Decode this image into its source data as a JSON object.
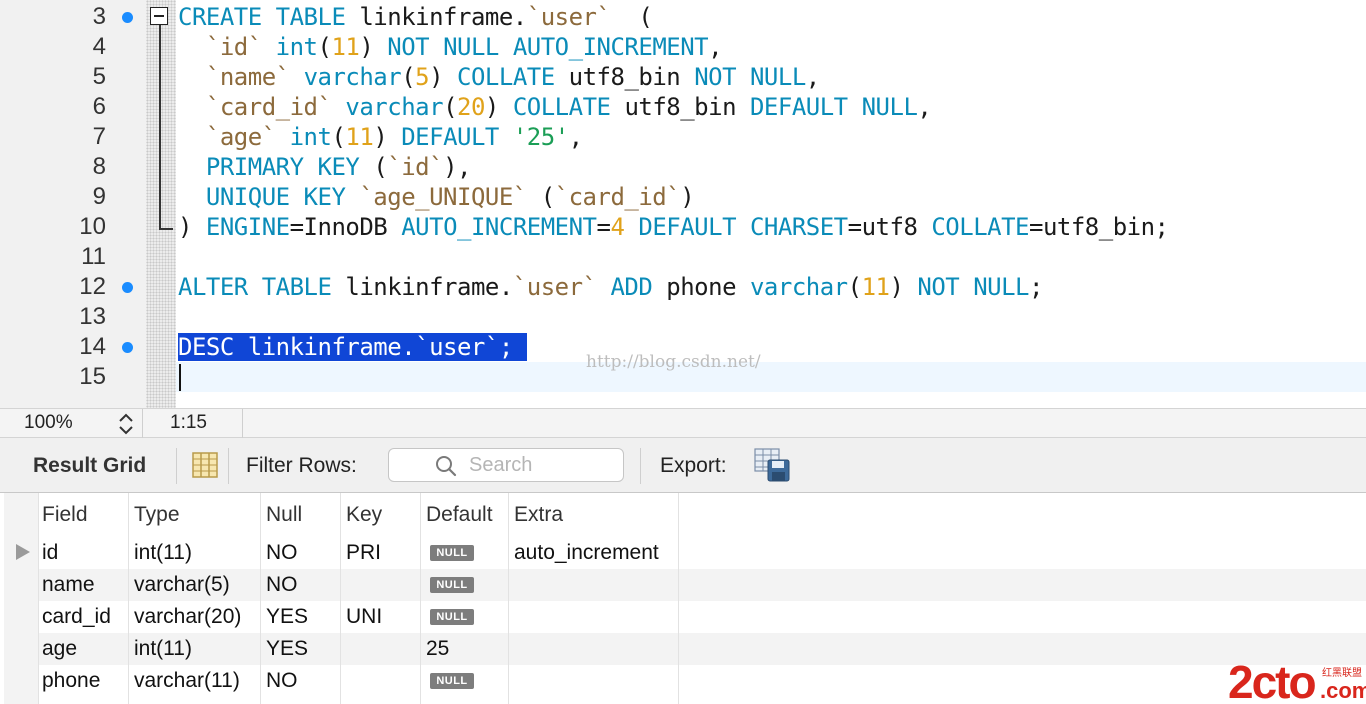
{
  "editor": {
    "lines": [
      {
        "num": "3",
        "marker": true
      },
      {
        "num": "4",
        "marker": false
      },
      {
        "num": "5",
        "marker": false
      },
      {
        "num": "6",
        "marker": false
      },
      {
        "num": "7",
        "marker": false
      },
      {
        "num": "8",
        "marker": false
      },
      {
        "num": "9",
        "marker": false
      },
      {
        "num": "10",
        "marker": false
      },
      {
        "num": "11",
        "marker": false
      },
      {
        "num": "12",
        "marker": true
      },
      {
        "num": "13",
        "marker": false
      },
      {
        "num": "14",
        "marker": true
      },
      {
        "num": "15",
        "marker": false
      }
    ],
    "code": {
      "l3": [
        "CREATE",
        "TABLE",
        "linkinframe.",
        "`user`",
        "("
      ],
      "l4": [
        "`id`",
        "int",
        "(",
        "11",
        ")",
        "NOT NULL",
        "AUTO_INCREMENT",
        ","
      ],
      "l5": [
        "`name`",
        "varchar",
        "(",
        "5",
        ")",
        "COLLATE",
        "utf8_bin",
        "NOT NULL",
        ","
      ],
      "l6": [
        "`card_id`",
        "varchar",
        "(",
        "20",
        ")",
        "COLLATE",
        "utf8_bin",
        "DEFAULT",
        "NULL",
        ","
      ],
      "l7": [
        "`age`",
        "int",
        "(",
        "11",
        ")",
        "DEFAULT",
        "'25'",
        ","
      ],
      "l8": [
        "PRIMARY KEY",
        "(",
        "`id`",
        "),"
      ],
      "l9": [
        "UNIQUE KEY",
        "`age_UNIQUE`",
        "(",
        "`card_id`",
        ")"
      ],
      "l10": [
        ")",
        "ENGINE",
        "=InnoDB",
        "AUTO_INCREMENT",
        "=",
        "4",
        "DEFAULT",
        "CHARSET",
        "=utf8",
        "COLLATE",
        "=utf8_bin;"
      ],
      "l12": [
        "ALTER",
        "TABLE",
        "linkinframe.",
        "`user`",
        "ADD",
        "phone",
        "varchar",
        "(",
        "11",
        ")",
        "NOT NULL",
        ";"
      ],
      "l14": "DESC linkinframe.`user`; "
    },
    "watermark": "http://blog.csdn.net/"
  },
  "status_bar": {
    "zoom": "100%",
    "cursor_position": "1:15"
  },
  "result_toolbar": {
    "title": "Result Grid",
    "filter_label": "Filter Rows:",
    "search_placeholder": "Search",
    "search_value": "",
    "export_label": "Export:"
  },
  "result_grid": {
    "columns": [
      "Field",
      "Type",
      "Null",
      "Key",
      "Default",
      "Extra"
    ],
    "null_badge": "NULL",
    "rows": [
      {
        "field": "id",
        "type": "int(11)",
        "null": "NO",
        "key": "PRI",
        "default": null,
        "extra": "auto_increment"
      },
      {
        "field": "name",
        "type": "varchar(5)",
        "null": "NO",
        "key": "",
        "default": null,
        "extra": ""
      },
      {
        "field": "card_id",
        "type": "varchar(20)",
        "null": "YES",
        "key": "UNI",
        "default": null,
        "extra": ""
      },
      {
        "field": "age",
        "type": "int(11)",
        "null": "YES",
        "key": "",
        "default": "25",
        "extra": ""
      },
      {
        "field": "phone",
        "type": "varchar(11)",
        "null": "NO",
        "key": "",
        "default": null,
        "extra": ""
      }
    ]
  },
  "logo": {
    "main": "2cto",
    "suffix": ".com",
    "tag": "红黑联盟"
  },
  "colors": {
    "keyword": "#0a8bb8",
    "backtick_identifier": "#8c6a3c",
    "number": "#e0a21a",
    "string": "#1b9e56",
    "selection": "#1046d6",
    "marker": "#1a8cff",
    "null_badge": "#7d7d7d",
    "logo": "#d9261c"
  }
}
